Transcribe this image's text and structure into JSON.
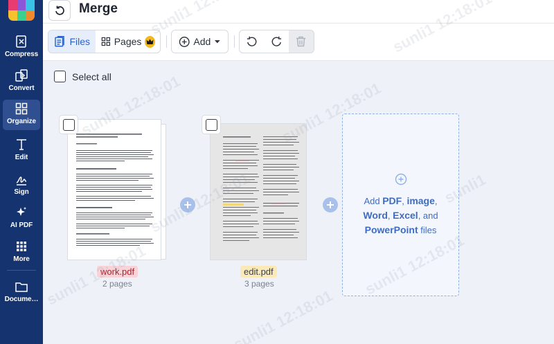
{
  "colors": {
    "sidebar_bg": "#15336e",
    "accent": "#2a62c9",
    "work_tag_bg": "#f8d4d8",
    "edit_tag_bg": "#fbeab8",
    "crown": "#f3b81f",
    "logo": [
      "#e83b6f",
      "#8b56d8",
      "#39c1e8",
      "#f6c22d",
      "#3ad08d",
      "#f08a2c"
    ]
  },
  "sidebar": {
    "items": [
      {
        "label": "Compress",
        "icon": "compress-icon"
      },
      {
        "label": "Convert",
        "icon": "convert-icon"
      },
      {
        "label": "Organize",
        "icon": "organize-icon",
        "active": true
      },
      {
        "label": "Edit",
        "icon": "edit-icon"
      },
      {
        "label": "Sign",
        "icon": "sign-icon"
      },
      {
        "label": "AI PDF",
        "icon": "ai-sparkle-icon"
      },
      {
        "label": "More",
        "icon": "more-grid-icon"
      },
      {
        "label": "Docume…",
        "icon": "folder-icon"
      }
    ]
  },
  "header": {
    "title": "Merge",
    "back_icon": "undo-arrow-icon"
  },
  "toolbar": {
    "files_label": "Files",
    "pages_label": "Pages",
    "add_label": "Add",
    "view_mode_selected": "Files"
  },
  "workspace": {
    "select_all_label": "Select all",
    "files": [
      {
        "name": "work.pdf",
        "pages": "2 pages"
      },
      {
        "name": "edit.pdf",
        "pages": "3 pages"
      }
    ],
    "drop_zone": {
      "t1": "Add ",
      "pdf": "PDF",
      "t2": ", ",
      "image": "image",
      "t3": ",",
      "word": "Word",
      "t4": ", ",
      "excel": "Excel",
      "t5": ", and",
      "ppt": "PowerPoint",
      "t6": " files"
    }
  },
  "watermark": {
    "user": "sunli1",
    "time": "12:18:01"
  }
}
